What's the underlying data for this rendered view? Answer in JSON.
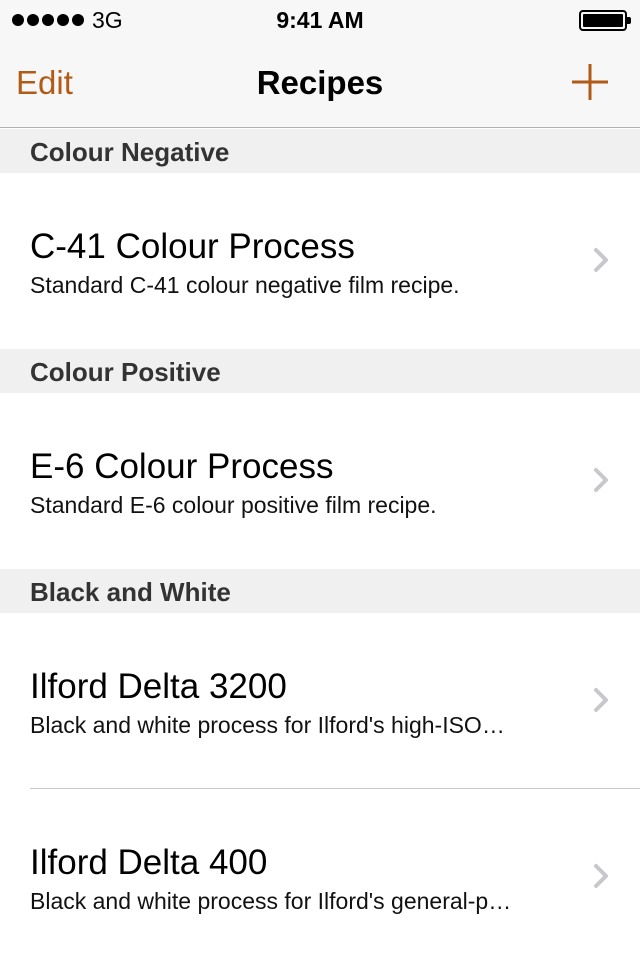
{
  "status_bar": {
    "carrier": "3G",
    "time": "9:41 AM"
  },
  "nav_bar": {
    "edit_label": "Edit",
    "title": "Recipes",
    "add_icon": "plus-icon"
  },
  "colors": {
    "accent": "#b25b17",
    "section_background": "#f0f0f0",
    "bar_background": "#f7f7f7",
    "chevron": "#c7c7cc"
  },
  "sections": [
    {
      "header": "Colour Negative",
      "items": [
        {
          "title": "C-41 Colour Process",
          "subtitle": "Standard C-41 colour negative film recipe."
        }
      ]
    },
    {
      "header": "Colour Positive",
      "items": [
        {
          "title": "E-6 Colour Process",
          "subtitle": "Standard E-6 colour positive film recipe."
        }
      ]
    },
    {
      "header": "Black and White",
      "items": [
        {
          "title": "Ilford Delta 3200",
          "subtitle": "Black and white process for Ilford's high-ISO…"
        },
        {
          "title": "Ilford Delta 400",
          "subtitle": "Black and white process for Ilford's general-p…"
        }
      ]
    }
  ]
}
